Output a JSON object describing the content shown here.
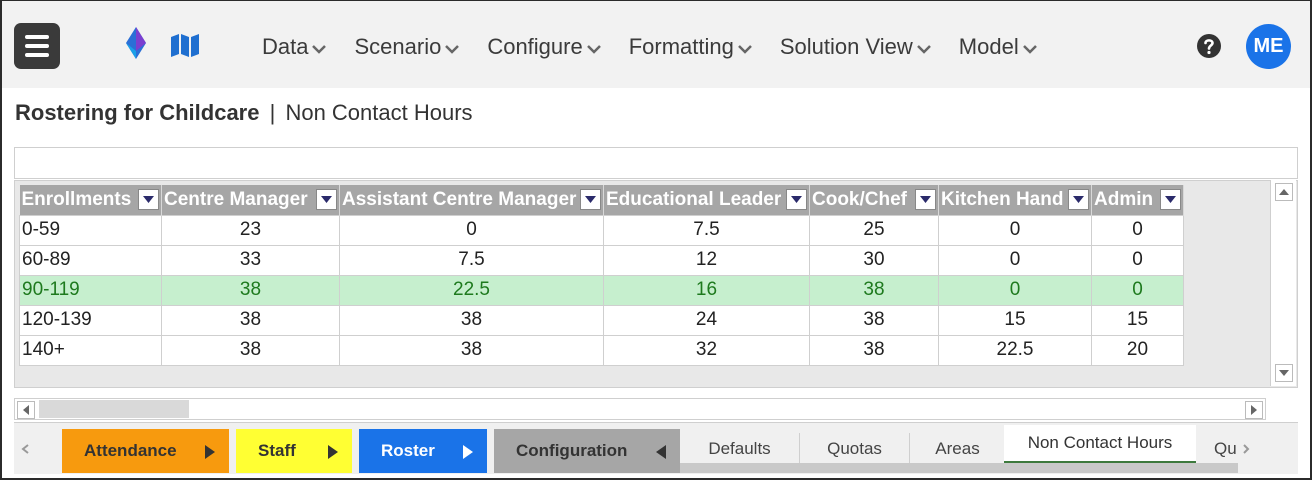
{
  "header": {
    "nav": [
      {
        "label": "Data"
      },
      {
        "label": "Scenario"
      },
      {
        "label": "Configure"
      },
      {
        "label": "Formatting"
      },
      {
        "label": "Solution View"
      },
      {
        "label": "Model"
      }
    ],
    "avatar_initials": "ME",
    "icons": [
      "hamburger-menu-icon",
      "app-logo-icon",
      "map-icon",
      "chevron-down-icon",
      "help-icon"
    ],
    "colors": {
      "avatar": "#1a73e8",
      "menu_button": "#3a3a3a"
    }
  },
  "page": {
    "title": "Rostering for Childcare",
    "separator": "|",
    "subtitle": "Non Contact Hours"
  },
  "formula_bar": {
    "value": ""
  },
  "grid": {
    "columns": [
      "Enrollments",
      "Centre Manager",
      "Assistant Centre Manager",
      "Educational Leader",
      "Cook/Chef",
      "Kitchen Hand",
      "Admin"
    ],
    "rows": [
      [
        "0-59",
        "23",
        "0",
        "7.5",
        "25",
        "0",
        "0"
      ],
      [
        "60-89",
        "33",
        "7.5",
        "12",
        "30",
        "0",
        "0"
      ],
      [
        "90-119",
        "38",
        "22.5",
        "16",
        "38",
        "0",
        "0"
      ],
      [
        "120-139",
        "38",
        "38",
        "24",
        "38",
        "15",
        "15"
      ],
      [
        "140+",
        "38",
        "38",
        "32",
        "38",
        "22.5",
        "20"
      ]
    ],
    "selected_row": 2,
    "colors": {
      "header_bg": "#a6a6a6",
      "selected_bg": "#c6efce",
      "selected_text": "#1e7a1e"
    }
  },
  "tabs": {
    "groups": [
      {
        "label": "Attendance",
        "color": "#f79a0e"
      },
      {
        "label": "Staff",
        "color": "#ffff33"
      },
      {
        "label": "Roster",
        "color": "#1a73e8"
      },
      {
        "label": "Configuration",
        "color": "#a6a6a6"
      }
    ],
    "sheets": [
      {
        "label": "Defaults"
      },
      {
        "label": "Quotas"
      },
      {
        "label": "Areas"
      },
      {
        "label": "Non Contact Hours",
        "active": true
      },
      {
        "label": "Qu"
      }
    ]
  }
}
